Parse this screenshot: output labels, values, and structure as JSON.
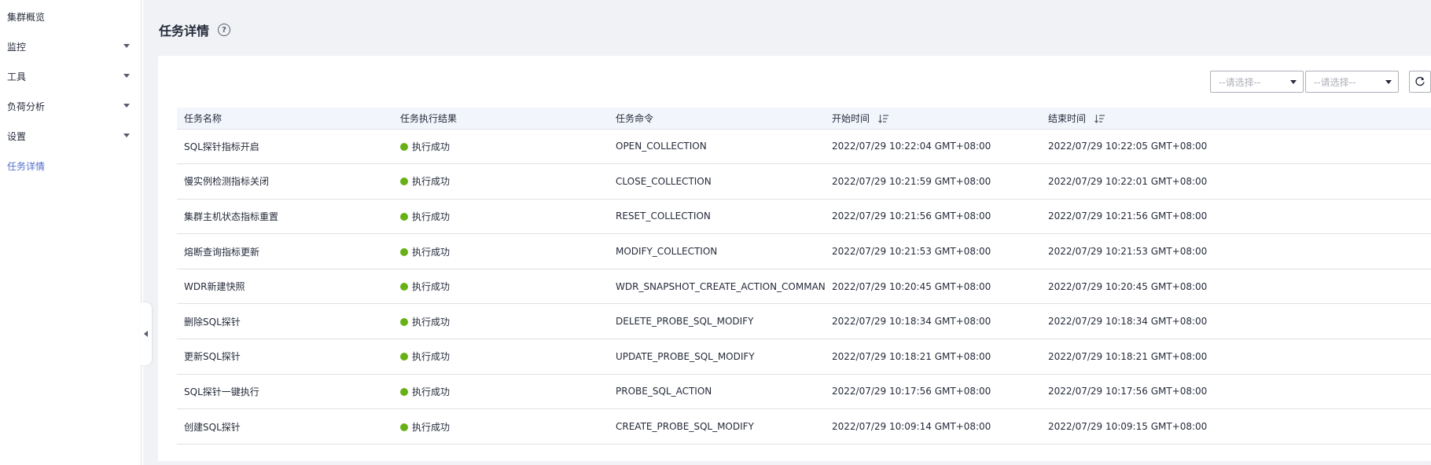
{
  "sidebar": {
    "items": [
      {
        "label": "集群概览",
        "has_caret": false,
        "active": false
      },
      {
        "label": "监控",
        "has_caret": true,
        "active": false
      },
      {
        "label": "工具",
        "has_caret": true,
        "active": false
      },
      {
        "label": "负荷分析",
        "has_caret": true,
        "active": false
      },
      {
        "label": "设置",
        "has_caret": true,
        "active": false
      },
      {
        "label": "任务详情",
        "has_caret": false,
        "active": true
      }
    ]
  },
  "header": {
    "title": "任务详情",
    "help_icon": "question-circle-icon"
  },
  "toolbar": {
    "filter1_placeholder": "--请选择--",
    "filter2_placeholder": "--请选择--",
    "refresh_icon": "refresh-icon"
  },
  "table": {
    "columns": [
      "任务名称",
      "任务执行结果",
      "任务命令",
      "开始时间",
      "结束时间"
    ],
    "status_color": "#67b116",
    "rows": [
      {
        "name": "SQL探针指标开启",
        "result": "执行成功",
        "command": "OPEN_COLLECTION",
        "start": "2022/07/29 10:22:04 GMT+08:00",
        "end": "2022/07/29 10:22:05 GMT+08:00"
      },
      {
        "name": "慢实例检测指标关闭",
        "result": "执行成功",
        "command": "CLOSE_COLLECTION",
        "start": "2022/07/29 10:21:59 GMT+08:00",
        "end": "2022/07/29 10:22:01 GMT+08:00"
      },
      {
        "name": "集群主机状态指标重置",
        "result": "执行成功",
        "command": "RESET_COLLECTION",
        "start": "2022/07/29 10:21:56 GMT+08:00",
        "end": "2022/07/29 10:21:56 GMT+08:00"
      },
      {
        "name": "熔断查询指标更新",
        "result": "执行成功",
        "command": "MODIFY_COLLECTION",
        "start": "2022/07/29 10:21:53 GMT+08:00",
        "end": "2022/07/29 10:21:53 GMT+08:00"
      },
      {
        "name": "WDR新建快照",
        "result": "执行成功",
        "command": "WDR_SNAPSHOT_CREATE_ACTION_COMMAND",
        "start": "2022/07/29 10:20:45 GMT+08:00",
        "end": "2022/07/29 10:20:45 GMT+08:00"
      },
      {
        "name": "删除SQL探针",
        "result": "执行成功",
        "command": "DELETE_PROBE_SQL_MODIFY",
        "start": "2022/07/29 10:18:34 GMT+08:00",
        "end": "2022/07/29 10:18:34 GMT+08:00"
      },
      {
        "name": "更新SQL探针",
        "result": "执行成功",
        "command": "UPDATE_PROBE_SQL_MODIFY",
        "start": "2022/07/29 10:18:21 GMT+08:00",
        "end": "2022/07/29 10:18:21 GMT+08:00"
      },
      {
        "name": "SQL探针一键执行",
        "result": "执行成功",
        "command": "PROBE_SQL_ACTION",
        "start": "2022/07/29 10:17:56 GMT+08:00",
        "end": "2022/07/29 10:17:56 GMT+08:00"
      },
      {
        "name": "创建SQL探针",
        "result": "执行成功",
        "command": "CREATE_PROBE_SQL_MODIFY",
        "start": "2022/07/29 10:09:14 GMT+08:00",
        "end": "2022/07/29 10:09:15 GMT+08:00"
      }
    ]
  }
}
